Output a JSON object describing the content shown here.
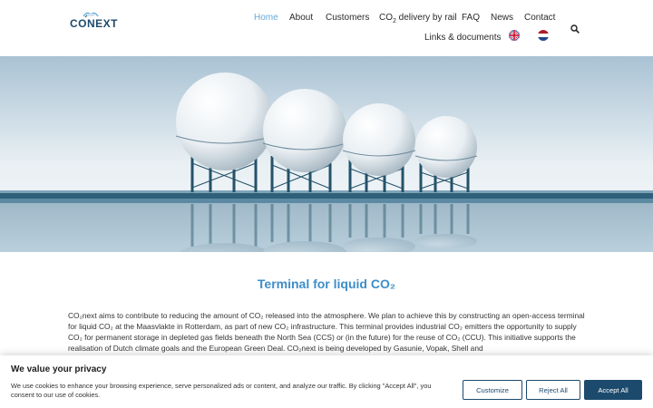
{
  "logo": {
    "text": "CONEXT"
  },
  "nav": {
    "home": "Home",
    "about": "About",
    "customers": "Customers",
    "co2_delivery_prefix": "CO",
    "co2_delivery_suffix": " delivery by rail",
    "faq": "FAQ",
    "news": "News",
    "contact": "Contact",
    "links": "Links & documents"
  },
  "icons": {
    "search": "search-icon",
    "flag_en": "uk-flag-icon",
    "flag_nl": "nl-flag-icon"
  },
  "content": {
    "title": "Terminal for liquid CO₂",
    "paragraph": "CO₂next aims to contribute to reducing the amount of CO₂ released into the atmosphere. We plan to achieve this by constructing an open-access terminal for liquid CO₂ at the Maasvlakte in Rotterdam, as part of new CO₂ infrastructure. This terminal provides industrial CO₂ emitters the opportunity to supply CO₂ for permanent storage in depleted gas fields beneath the North Sea (CCS) or (in the future) for the reuse of CO₂ (CCU). This initiative supports the realisation of Dutch climate goals and the European Green Deal. CO₂next is being developed by Gasunie, Vopak, Shell and"
  },
  "cookie": {
    "title": "We value your privacy",
    "text": "We use cookies to enhance your browsing experience, serve personalized ads or content, and analyze our traffic. By clicking \"Accept All\", you consent to our use of cookies.",
    "customize": "Customize",
    "reject": "Reject All",
    "accept": "Accept All"
  },
  "colors": {
    "accent": "#3d8ec9",
    "nav_active": "#66a9d6",
    "brand_dark": "#1c4a6c"
  }
}
